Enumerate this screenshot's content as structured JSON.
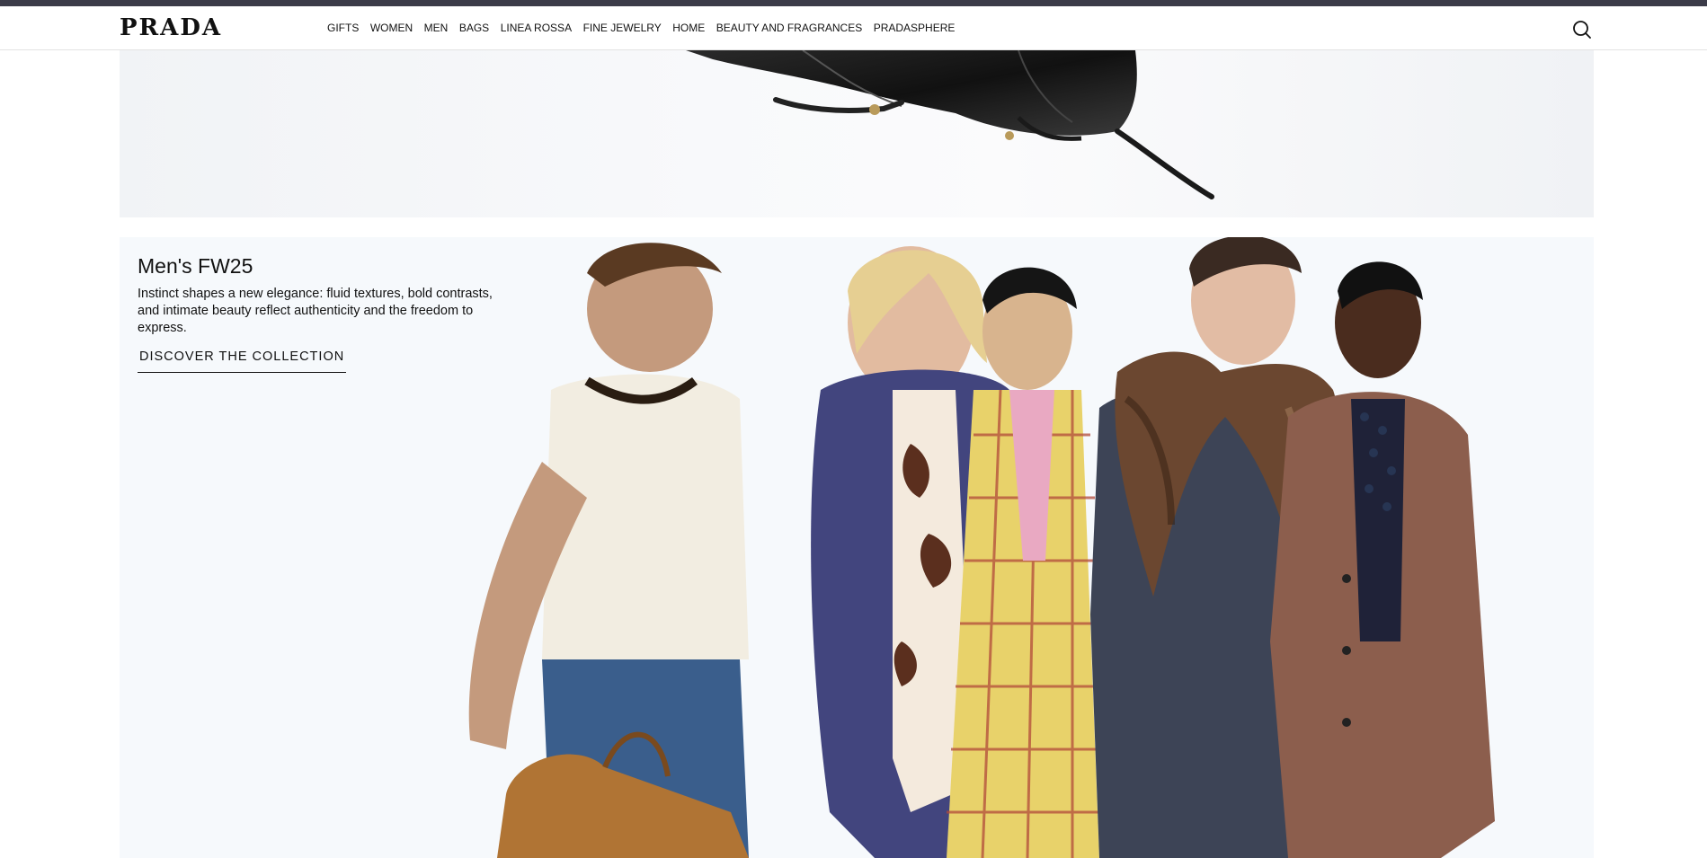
{
  "brand": {
    "logo": "PRADA"
  },
  "nav": {
    "items": [
      {
        "label": "GIFTS"
      },
      {
        "label": "WOMEN"
      },
      {
        "label": "MEN"
      },
      {
        "label": "BAGS"
      },
      {
        "label": "LINEA ROSSA"
      },
      {
        "label": "FINE JEWELRY"
      },
      {
        "label": "HOME"
      },
      {
        "label": "BEAUTY AND FRAGRANCES"
      },
      {
        "label": "PRADASPHERE"
      }
    ],
    "search_icon": "search-icon"
  },
  "hero_bag": {
    "image": "black-leather-bag-photo"
  },
  "hero_men": {
    "title": "Men's FW25",
    "description": "Instinct shapes a new elegance: fluid textures, bold contrasts, and intimate beauty reflect authenticity and the freedom to express.",
    "cta_label": "DISCOVER THE COLLECTION",
    "image": "mens-collection-models-photo"
  },
  "colors": {
    "topbar": "#3b3b48",
    "text": "#111111",
    "hero_bg": "#f6f9fc"
  }
}
